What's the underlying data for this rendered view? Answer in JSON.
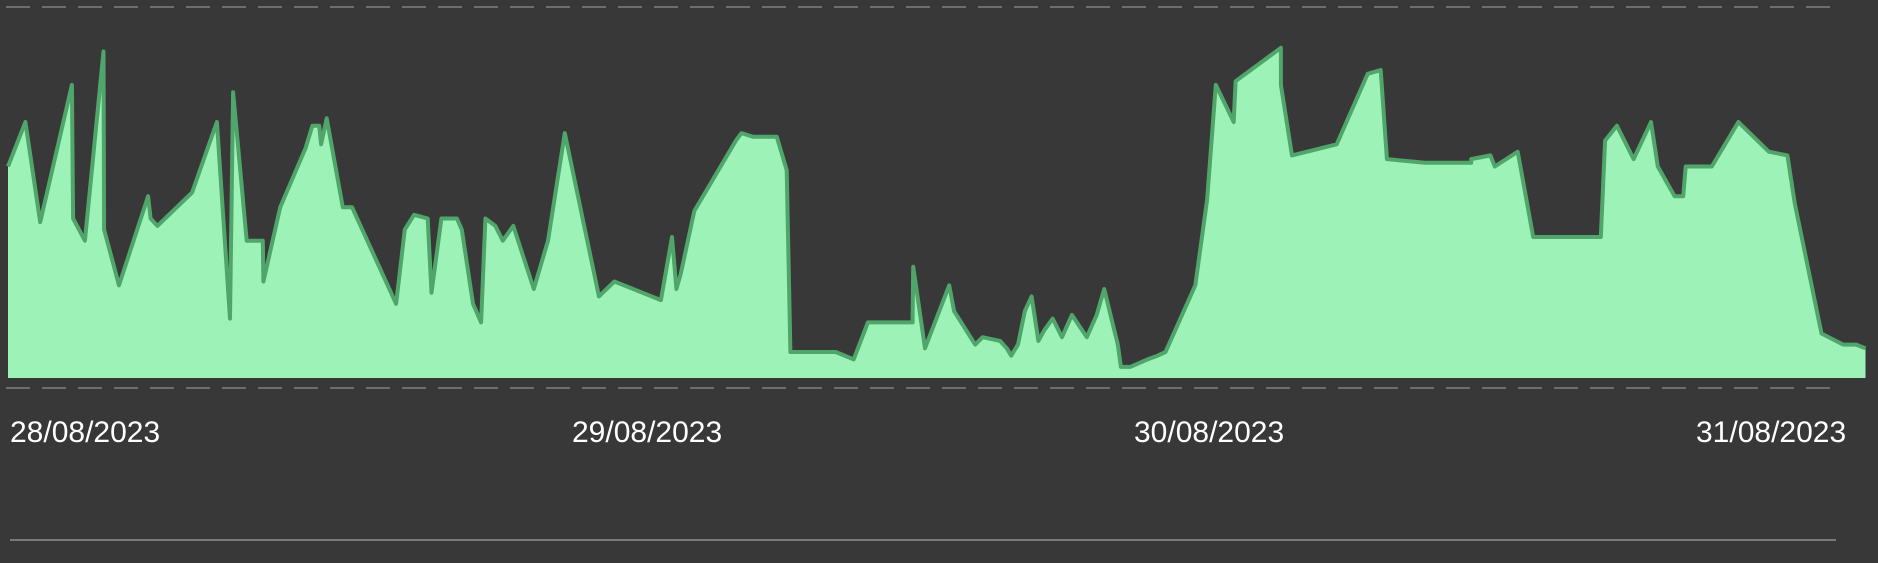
{
  "colors": {
    "background": "#383838",
    "area_fill": "#9df2b7",
    "area_stroke": "#4fa56a",
    "grid_line": "#6e6e6e",
    "baseline": "#7a7a7a",
    "text": "#ffffff"
  },
  "chart_data": {
    "type": "area",
    "title": "",
    "xlabel": "",
    "ylabel": "",
    "grid": true,
    "grid_style": "dashed horizontal lines at top and bottom",
    "legend": "none",
    "x_tick_labels": [
      "28/08/2023",
      "29/08/2023",
      "30/08/2023",
      "31/08/2023"
    ],
    "x_range": [
      0,
      3
    ],
    "ylim": [
      0,
      100
    ],
    "series": [
      {
        "x": [
          0.0,
          0.028,
          0.052,
          0.103,
          0.105,
          0.124,
          0.154,
          0.155,
          0.179,
          0.226,
          0.23,
          0.241,
          0.297,
          0.337,
          0.358,
          0.363,
          0.385,
          0.411,
          0.412,
          0.439,
          0.48,
          0.491,
          0.502,
          0.505,
          0.514,
          0.54,
          0.555,
          0.626,
          0.64,
          0.655,
          0.677,
          0.683,
          0.699,
          0.724,
          0.732,
          0.75,
          0.763,
          0.77,
          0.786,
          0.798,
          0.815,
          0.848,
          0.871,
          0.898,
          0.953,
          0.978,
          1.053,
          1.071,
          1.078,
          1.085,
          1.107,
          1.174,
          1.183,
          1.202,
          1.24,
          1.256,
          1.262,
          1.298,
          1.335,
          1.364,
          1.387,
          1.459,
          1.46,
          1.479,
          1.518,
          1.526,
          1.56,
          1.572,
          1.6,
          1.611,
          1.618,
          1.629,
          1.64,
          1.651,
          1.662,
          1.672,
          1.685,
          1.7,
          1.716,
          1.74,
          1.756,
          1.768,
          1.79,
          1.795,
          1.81,
          1.838,
          1.854,
          1.867,
          1.915,
          1.934,
          1.948,
          1.977,
          1.98,
          2.053,
          2.053,
          2.071,
          2.143,
          2.193,
          2.214,
          2.224,
          2.286,
          2.31,
          2.333,
          2.36,
          2.36,
          2.391,
          2.398,
          2.435,
          2.46,
          2.485,
          2.513,
          2.541,
          2.569,
          2.576,
          2.595,
          2.622,
          2.65,
          2.661,
          2.688,
          2.702,
          2.706,
          2.748,
          2.791,
          2.84,
          2.87,
          2.882,
          2.925,
          2.96,
          2.981,
          2.996
        ],
        "y": [
          57,
          69,
          42,
          79,
          43,
          37,
          88,
          40,
          25,
          49,
          43,
          41,
          50,
          69,
          16,
          77,
          37,
          37,
          26,
          46,
          62,
          68,
          68,
          63,
          70,
          46,
          46,
          20,
          40,
          44,
          43,
          23,
          43,
          43,
          40,
          20,
          15,
          43,
          41,
          37,
          41,
          24,
          37,
          66,
          22,
          26,
          21,
          38,
          24,
          28,
          45,
          64,
          66,
          65,
          65,
          56,
          7,
          7,
          7,
          5,
          15,
          15,
          30,
          8,
          25,
          18,
          9,
          11,
          10,
          8,
          6,
          9,
          18,
          22,
          10,
          13,
          16,
          11,
          17,
          11,
          17,
          24,
          9,
          3,
          3,
          5,
          6,
          7,
          25,
          48,
          79,
          69,
          80,
          89,
          79,
          60,
          63,
          82,
          83,
          59,
          58,
          58,
          58,
          58,
          59,
          60,
          57,
          61,
          38,
          38,
          38,
          38,
          38,
          64,
          68,
          59,
          69,
          57,
          49,
          49,
          57,
          57,
          69,
          61,
          60,
          47,
          12,
          9,
          9,
          8
        ]
      }
    ]
  }
}
